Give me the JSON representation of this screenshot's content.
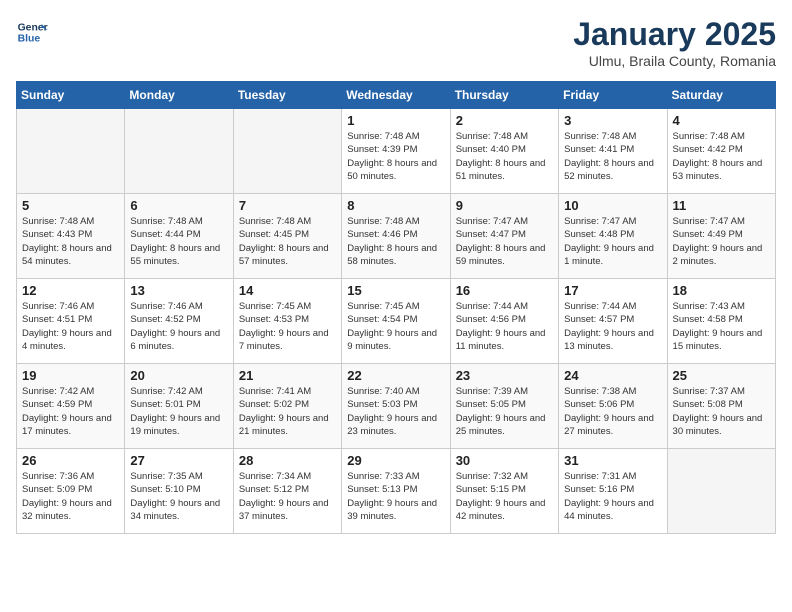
{
  "header": {
    "logo_line1": "General",
    "logo_line2": "Blue",
    "month": "January 2025",
    "location": "Ulmu, Braila County, Romania"
  },
  "weekdays": [
    "Sunday",
    "Monday",
    "Tuesday",
    "Wednesday",
    "Thursday",
    "Friday",
    "Saturday"
  ],
  "weeks": [
    [
      {
        "day": "",
        "empty": true
      },
      {
        "day": "",
        "empty": true
      },
      {
        "day": "",
        "empty": true
      },
      {
        "day": "1",
        "sunrise": "7:48 AM",
        "sunset": "4:39 PM",
        "daylight": "8 hours and 50 minutes."
      },
      {
        "day": "2",
        "sunrise": "7:48 AM",
        "sunset": "4:40 PM",
        "daylight": "8 hours and 51 minutes."
      },
      {
        "day": "3",
        "sunrise": "7:48 AM",
        "sunset": "4:41 PM",
        "daylight": "8 hours and 52 minutes."
      },
      {
        "day": "4",
        "sunrise": "7:48 AM",
        "sunset": "4:42 PM",
        "daylight": "8 hours and 53 minutes."
      }
    ],
    [
      {
        "day": "5",
        "sunrise": "7:48 AM",
        "sunset": "4:43 PM",
        "daylight": "8 hours and 54 minutes."
      },
      {
        "day": "6",
        "sunrise": "7:48 AM",
        "sunset": "4:44 PM",
        "daylight": "8 hours and 55 minutes."
      },
      {
        "day": "7",
        "sunrise": "7:48 AM",
        "sunset": "4:45 PM",
        "daylight": "8 hours and 57 minutes."
      },
      {
        "day": "8",
        "sunrise": "7:48 AM",
        "sunset": "4:46 PM",
        "daylight": "8 hours and 58 minutes."
      },
      {
        "day": "9",
        "sunrise": "7:47 AM",
        "sunset": "4:47 PM",
        "daylight": "8 hours and 59 minutes."
      },
      {
        "day": "10",
        "sunrise": "7:47 AM",
        "sunset": "4:48 PM",
        "daylight": "9 hours and 1 minute."
      },
      {
        "day": "11",
        "sunrise": "7:47 AM",
        "sunset": "4:49 PM",
        "daylight": "9 hours and 2 minutes."
      }
    ],
    [
      {
        "day": "12",
        "sunrise": "7:46 AM",
        "sunset": "4:51 PM",
        "daylight": "9 hours and 4 minutes."
      },
      {
        "day": "13",
        "sunrise": "7:46 AM",
        "sunset": "4:52 PM",
        "daylight": "9 hours and 6 minutes."
      },
      {
        "day": "14",
        "sunrise": "7:45 AM",
        "sunset": "4:53 PM",
        "daylight": "9 hours and 7 minutes."
      },
      {
        "day": "15",
        "sunrise": "7:45 AM",
        "sunset": "4:54 PM",
        "daylight": "9 hours and 9 minutes."
      },
      {
        "day": "16",
        "sunrise": "7:44 AM",
        "sunset": "4:56 PM",
        "daylight": "9 hours and 11 minutes."
      },
      {
        "day": "17",
        "sunrise": "7:44 AM",
        "sunset": "4:57 PM",
        "daylight": "9 hours and 13 minutes."
      },
      {
        "day": "18",
        "sunrise": "7:43 AM",
        "sunset": "4:58 PM",
        "daylight": "9 hours and 15 minutes."
      }
    ],
    [
      {
        "day": "19",
        "sunrise": "7:42 AM",
        "sunset": "4:59 PM",
        "daylight": "9 hours and 17 minutes."
      },
      {
        "day": "20",
        "sunrise": "7:42 AM",
        "sunset": "5:01 PM",
        "daylight": "9 hours and 19 minutes."
      },
      {
        "day": "21",
        "sunrise": "7:41 AM",
        "sunset": "5:02 PM",
        "daylight": "9 hours and 21 minutes."
      },
      {
        "day": "22",
        "sunrise": "7:40 AM",
        "sunset": "5:03 PM",
        "daylight": "9 hours and 23 minutes."
      },
      {
        "day": "23",
        "sunrise": "7:39 AM",
        "sunset": "5:05 PM",
        "daylight": "9 hours and 25 minutes."
      },
      {
        "day": "24",
        "sunrise": "7:38 AM",
        "sunset": "5:06 PM",
        "daylight": "9 hours and 27 minutes."
      },
      {
        "day": "25",
        "sunrise": "7:37 AM",
        "sunset": "5:08 PM",
        "daylight": "9 hours and 30 minutes."
      }
    ],
    [
      {
        "day": "26",
        "sunrise": "7:36 AM",
        "sunset": "5:09 PM",
        "daylight": "9 hours and 32 minutes."
      },
      {
        "day": "27",
        "sunrise": "7:35 AM",
        "sunset": "5:10 PM",
        "daylight": "9 hours and 34 minutes."
      },
      {
        "day": "28",
        "sunrise": "7:34 AM",
        "sunset": "5:12 PM",
        "daylight": "9 hours and 37 minutes."
      },
      {
        "day": "29",
        "sunrise": "7:33 AM",
        "sunset": "5:13 PM",
        "daylight": "9 hours and 39 minutes."
      },
      {
        "day": "30",
        "sunrise": "7:32 AM",
        "sunset": "5:15 PM",
        "daylight": "9 hours and 42 minutes."
      },
      {
        "day": "31",
        "sunrise": "7:31 AM",
        "sunset": "5:16 PM",
        "daylight": "9 hours and 44 minutes."
      },
      {
        "day": "",
        "empty": true
      }
    ]
  ]
}
